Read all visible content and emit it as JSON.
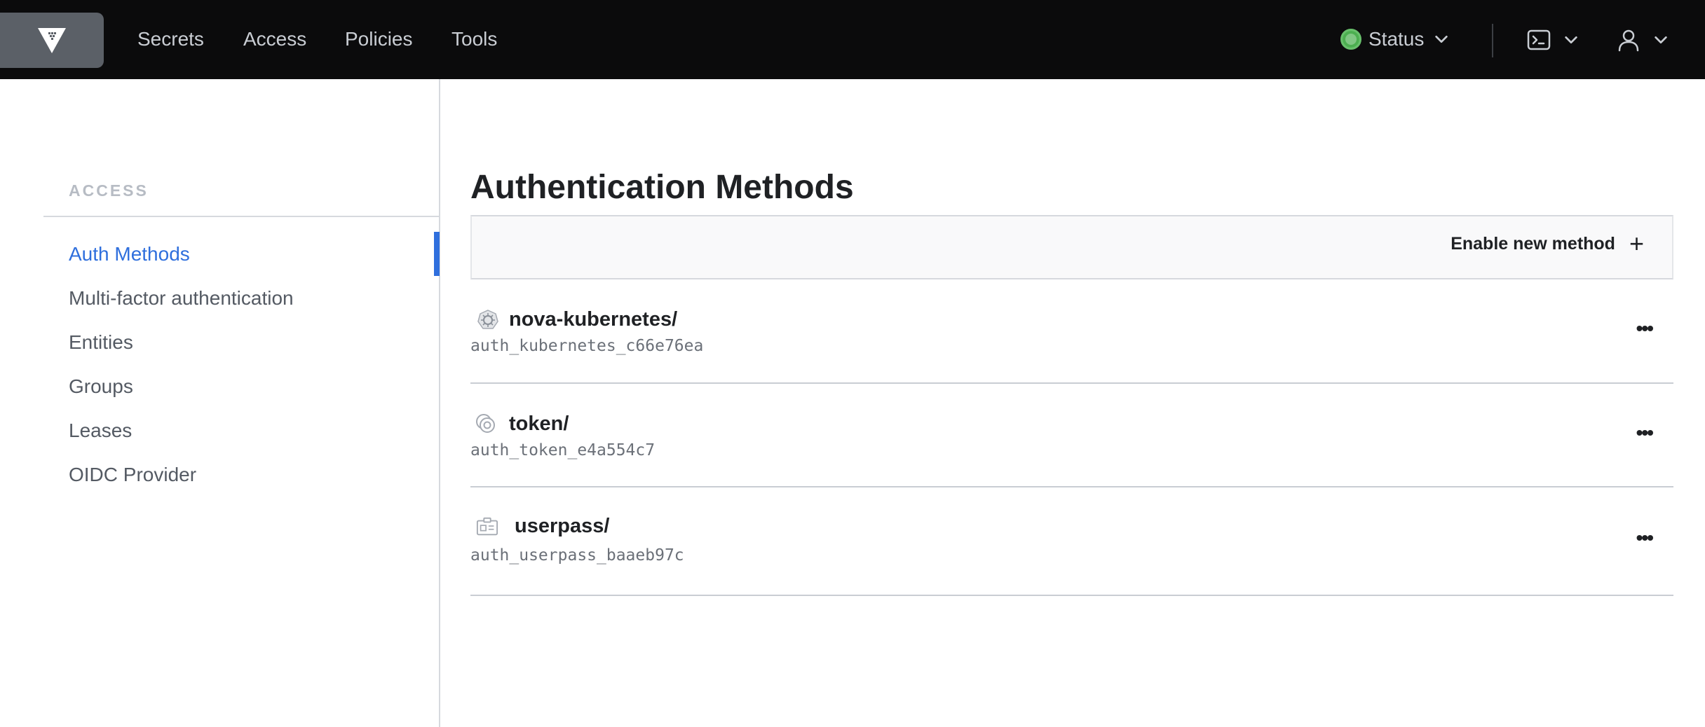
{
  "colors": {
    "topbar_bg": "#0b0b0c",
    "accent": "#2f6fdd",
    "status_ok": "#81c784"
  },
  "header": {
    "logo_icon": "vault-logo-icon",
    "nav": [
      "Secrets",
      "Access",
      "Policies",
      "Tools"
    ],
    "status_label": "Status",
    "icons": [
      "status-dot-icon",
      "chevron-down-icon",
      "console-icon",
      "user-icon"
    ]
  },
  "sidebar": {
    "heading": "ACCESS",
    "items": [
      {
        "label": "Auth Methods",
        "active": true
      },
      {
        "label": "Multi-factor authentication",
        "active": false
      },
      {
        "label": "Entities",
        "active": false
      },
      {
        "label": "Groups",
        "active": false
      },
      {
        "label": "Leases",
        "active": false
      },
      {
        "label": "OIDC Provider",
        "active": false
      }
    ]
  },
  "main": {
    "title": "Authentication Methods",
    "enable_button": "Enable new method",
    "enable_icon": "plus-icon",
    "methods": [
      {
        "name": "nova-kubernetes/",
        "accessor": "auth_kubernetes_c66e76ea",
        "icon": "kubernetes-icon"
      },
      {
        "name": "token/",
        "accessor": "auth_token_e4a554c7",
        "icon": "token-icon"
      },
      {
        "name": "userpass/",
        "accessor": "auth_userpass_baaeb97c",
        "icon": "userpass-icon"
      }
    ],
    "row_menu_label": "•••"
  }
}
